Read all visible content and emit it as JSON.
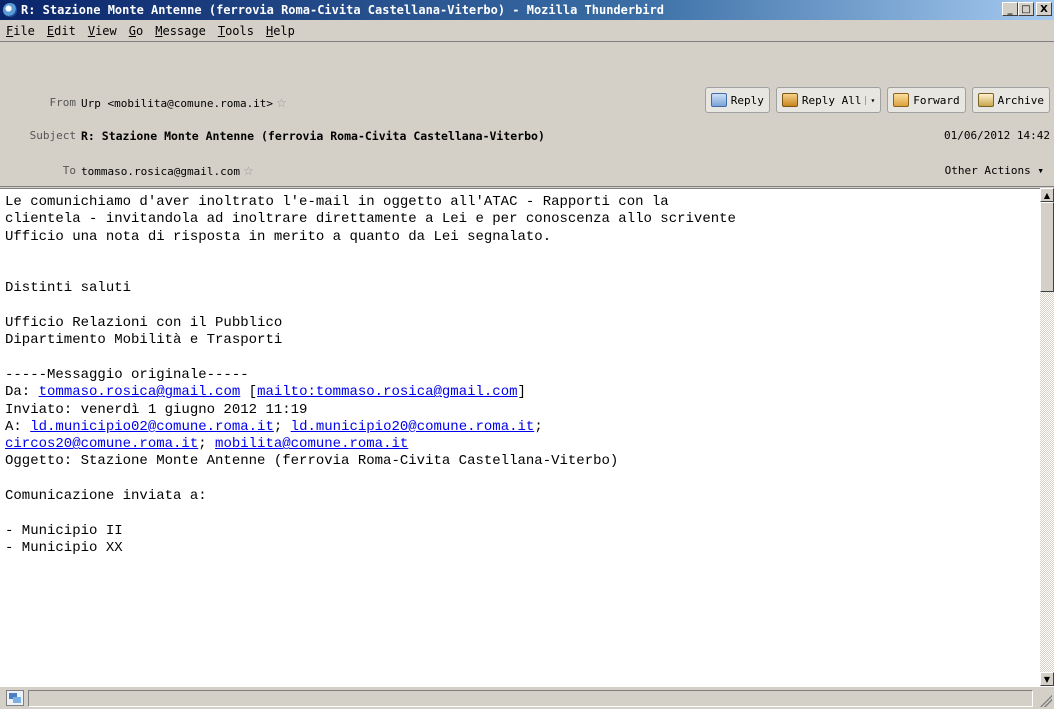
{
  "window": {
    "title": "R: Stazione Monte Antenne (ferrovia Roma-Civita Castellana-Viterbo) - Mozilla Thunderbird",
    "minimize": "_",
    "maximize": "□",
    "close": "X"
  },
  "menu": {
    "items": [
      {
        "u": "F",
        "rest": "ile"
      },
      {
        "u": "E",
        "rest": "dit"
      },
      {
        "u": "V",
        "rest": "iew"
      },
      {
        "u": "G",
        "rest": "o"
      },
      {
        "u": "M",
        "rest": "essage"
      },
      {
        "u": "T",
        "rest": "ools"
      },
      {
        "u": "H",
        "rest": "elp"
      }
    ]
  },
  "header": {
    "from_label": "From",
    "from_value": "Urp <mobilita@comune.roma.it>",
    "subject_label": "Subject",
    "subject_value": "R: Stazione Monte Antenne (ferrovia Roma-Civita Castellana-Viterbo)",
    "date": "01/06/2012 14:42",
    "to_label": "To",
    "to_value": "tommaso.rosica@gmail.com",
    "other_actions": "Other Actions ▾",
    "star": "☆"
  },
  "toolbar": {
    "reply": "Reply",
    "reply_all": "Reply All",
    "reply_all_arrow": "▾",
    "forward": "Forward",
    "archive": "Archive"
  },
  "body": {
    "line1": "Le comunichiamo d'aver inoltrato l'e-mail in oggetto all'ATAC - Rapporti con la",
    "line2": "clientela - invitandola ad inoltrare direttamente a Lei e per conoscenza allo scrivente",
    "line3": "Ufficio una nota di risposta in merito a quanto da Lei segnalato.",
    "saluti": "Distinti saluti",
    "sig1": "Ufficio Relazioni con il Pubblico",
    "sig2": "Dipartimento Mobilità e Trasporti",
    "orig_sep": "-----Messaggio originale-----",
    "da_label": "Da: ",
    "da_email": "tommaso.rosica@gmail.com",
    "da_mailto": "mailto:tommaso.rosica@gmail.com",
    "inviato": "Inviato: venerdì 1 giugno 2012 11:19",
    "a_label": "A: ",
    "a_email1": "ld.municipio02@comune.roma.it",
    "a_email2": "ld.municipio20@comune.roma.it",
    "a_email3": "circos20@comune.roma.it",
    "a_email4": "mobilita@comune.roma.it",
    "oggetto": "Oggetto: Stazione Monte Antenne (ferrovia Roma-Civita Castellana-Viterbo)",
    "comunicazione": "Comunicazione inviata a:",
    "mun1": "- Municipio II",
    "mun2": "- Municipio XX"
  },
  "scrollbar": {
    "up": "▲",
    "down": "▼"
  }
}
